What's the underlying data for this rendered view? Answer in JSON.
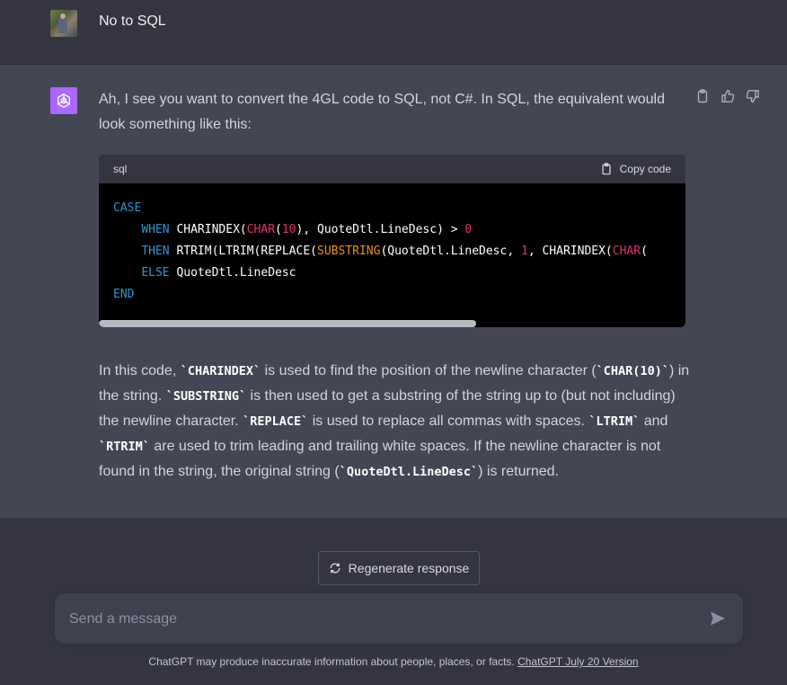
{
  "user_message": {
    "text": "No to SQL"
  },
  "assistant_message": {
    "intro": "Ah, I see you want to convert the 4GL code to SQL, not C#. In SQL, the equivalent would look something like this:",
    "code_language": "sql",
    "copy_label": "Copy code",
    "explanation": {
      "p1": "In this code, ",
      "c1": "`CHARINDEX`",
      "p2": " is used to find the position of the newline character (",
      "c2": "`CHAR(10)`",
      "p3": ") in the string. ",
      "c3": "`SUBSTRING`",
      "p4": " is then used to get a substring of the string up to (but not including) the newline character. ",
      "c4": "`REPLACE`",
      "p5": " is used to replace all commas with spaces. ",
      "c5": "`LTRIM`",
      "p6": " and ",
      "c6": "`RTRIM`",
      "p7": " are used to trim leading and trailing white spaces. If the newline character is not found in the string, the original string (",
      "c7": "`QuoteDtl.LineDesc`",
      "p8": ") is returned."
    }
  },
  "code_tokens": {
    "case": "CASE",
    "when": "WHEN",
    "charindex": "CHARINDEX",
    "char": "CHAR",
    "ten": "10",
    "l2_mid": "), QuoteDtl.LineDesc) > ",
    "zero": "0",
    "then": "THEN",
    "rtrim_ltrim_replace": "RTRIM(LTRIM(REPLACE(",
    "substring": "SUBSTRING",
    "l3_mid": "(QuoteDtl.LineDesc, ",
    "one": "1",
    "l3_tail": ", CHARINDEX(",
    "char2": "CHAR",
    "l3_end": "(",
    "else": "ELSE",
    "l4_rest": "QuoteDtl.LineDesc",
    "end": "END"
  },
  "regenerate_label": "Regenerate response",
  "input": {
    "placeholder": "Send a message"
  },
  "footer": {
    "text": "ChatGPT may produce inaccurate information about people, places, or facts. ",
    "link": "ChatGPT July 20 Version"
  },
  "colors": {
    "background": "#343541",
    "assistant_bg": "#444654",
    "accent": "#ab68ff",
    "code_keyword": "#2e95d3",
    "code_function": "#df3079",
    "code_builtin": "#e9950c"
  },
  "icons": {
    "copy": "clipboard-icon",
    "thumbs_up": "thumbs-up-icon",
    "thumbs_down": "thumbs-down-icon",
    "regenerate": "refresh-icon",
    "send": "send-icon",
    "openai": "openai-logo-icon"
  }
}
